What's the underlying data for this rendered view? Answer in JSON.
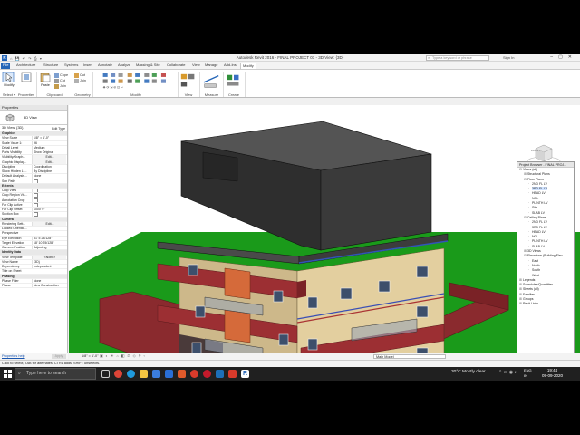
{
  "window": {
    "title": "Autodesk Revit 2016 -   FINAL PROJECT 01 - 3D View: {3D}",
    "search_placeholder": "Type a keyword or phrase",
    "sign_in": "Sign In",
    "quick_access": "⌂ 💾 ↶ ↷ ⎙ ▾"
  },
  "ribbon": {
    "tabs": [
      "File",
      "Architecture",
      "Structure",
      "Systems",
      "Insert",
      "Annotate",
      "Analyze",
      "Massing & Site",
      "Collaborate",
      "View",
      "Manage",
      "Add-Ins",
      "Modify"
    ],
    "active_tab": "Modify",
    "modify_label": "Modify",
    "properties_label": "Properties",
    "paste_label": "Paste",
    "clipboard_items": [
      "Cope",
      "Cut",
      "Join"
    ],
    "geometry_items": [
      "Cut",
      "Join"
    ],
    "panels": [
      "Select ▾",
      "Properties",
      "Clipboard",
      "Geometry",
      "Modify",
      "View",
      "Measure",
      "Create"
    ]
  },
  "properties": {
    "title": "Properties",
    "type_name": "3D View",
    "selector": "3D View: {3D}",
    "edit_type": "Edit Type",
    "rows": [
      {
        "k": "Graphics",
        "v": "",
        "cat": true
      },
      {
        "k": "View Scale",
        "v": "1/8\" = 1'-0\""
      },
      {
        "k": "Scale Value 1:",
        "v": "96"
      },
      {
        "k": "Detail Level",
        "v": "Medium"
      },
      {
        "k": "Parts Visibility",
        "v": "Show Original"
      },
      {
        "k": "Visibility/Graph...",
        "v": "Edit...",
        "btn": true
      },
      {
        "k": "Graphic Display...",
        "v": "Edit...",
        "btn": true
      },
      {
        "k": "Discipline",
        "v": "Coordination"
      },
      {
        "k": "Show Hidden Li...",
        "v": "By Discipline"
      },
      {
        "k": "Default Analysis...",
        "v": "None"
      },
      {
        "k": "Sun Path",
        "v": "",
        "chk": true
      },
      {
        "k": "Extents",
        "v": "",
        "cat": true
      },
      {
        "k": "Crop View",
        "v": "",
        "chk": true
      },
      {
        "k": "Crop Region Vis...",
        "v": "",
        "chk": true
      },
      {
        "k": "Annotation Crop",
        "v": "",
        "chk": true
      },
      {
        "k": "Far Clip Active",
        "v": "",
        "chk": true
      },
      {
        "k": "Far Clip Offset",
        "v": "1000' 0\""
      },
      {
        "k": "Section Box",
        "v": "",
        "chk": true
      },
      {
        "k": "Camera",
        "v": "",
        "cat": true
      },
      {
        "k": "Rendering Sett...",
        "v": "Edit...",
        "btn": true
      },
      {
        "k": "Locked Orientat...",
        "v": ""
      },
      {
        "k": "Perspective",
        "v": ""
      },
      {
        "k": "Eye Elevation",
        "v": "51' 5 23/128\""
      },
      {
        "k": "Target Elevation",
        "v": "18' 10 25/128\""
      },
      {
        "k": "Camera Position",
        "v": "Adjusting"
      },
      {
        "k": "Identity Data",
        "v": "",
        "cat": true
      },
      {
        "k": "View Template",
        "v": "<None>",
        "btn": true
      },
      {
        "k": "View Name",
        "v": "{3D}"
      },
      {
        "k": "Dependency",
        "v": "Independent"
      },
      {
        "k": "Title on Sheet",
        "v": ""
      },
      {
        "k": "Phasing",
        "v": "",
        "cat": true
      },
      {
        "k": "Phase Filter",
        "v": "None"
      },
      {
        "k": "Phase",
        "v": "New Construction"
      }
    ],
    "help_link": "Properties help",
    "apply": "Apply"
  },
  "browser": {
    "title": "Project Browser - FINAL PROJ...",
    "nodes": [
      {
        "t": "Views (all)",
        "d": 0,
        "tw": "⊟"
      },
      {
        "t": "Structural Plans",
        "d": 1,
        "tw": "⊞"
      },
      {
        "t": "Floor Plans",
        "d": 1,
        "tw": "⊟"
      },
      {
        "t": "2ND FL LV",
        "d": 2
      },
      {
        "t": "3RD FL LV",
        "d": 2,
        "sel": true
      },
      {
        "t": "HEAD LV",
        "d": 2
      },
      {
        "t": "NGL",
        "d": 2
      },
      {
        "t": "PLINTH LV",
        "d": 2
      },
      {
        "t": "Site",
        "d": 2
      },
      {
        "t": "SLAB LV",
        "d": 2
      },
      {
        "t": "Ceiling Plans",
        "d": 1,
        "tw": "⊟"
      },
      {
        "t": "2ND FL LV",
        "d": 2
      },
      {
        "t": "3RD FL LV",
        "d": 2
      },
      {
        "t": "HEAD LV",
        "d": 2
      },
      {
        "t": "NGL",
        "d": 2
      },
      {
        "t": "PLINTH LV",
        "d": 2
      },
      {
        "t": "SLAB LV",
        "d": 2
      },
      {
        "t": "3D Views",
        "d": 1,
        "tw": "⊞"
      },
      {
        "t": "Elevations (Building Elev...",
        "d": 1,
        "tw": "⊟"
      },
      {
        "t": "East",
        "d": 2
      },
      {
        "t": "North",
        "d": 2
      },
      {
        "t": "South",
        "d": 2
      },
      {
        "t": "West",
        "d": 2
      },
      {
        "t": "Legends",
        "d": 0,
        "tw": "⊞"
      },
      {
        "t": "Schedules/Quantities",
        "d": 0,
        "tw": "⊞"
      },
      {
        "t": "Sheets (all)",
        "d": 0,
        "tw": "⊞"
      },
      {
        "t": "Families",
        "d": 0,
        "tw": "⊞"
      },
      {
        "t": "Groups",
        "d": 0,
        "tw": "⊞"
      },
      {
        "t": "Revit Links",
        "d": 0,
        "tw": "⊞"
      }
    ]
  },
  "viewcube": {
    "face": "FRONT"
  },
  "viewbar": {
    "scale": "1/8\" = 1'-0\"",
    "model": "Main Model"
  },
  "statusbar": {
    "text": "Click to select, TAB for alternates, CTRL adds, SHIFT unselects."
  },
  "taskbar": {
    "search_placeholder": "Type here to search",
    "weather": "30°C  Mostly clear",
    "lang": "ENG\nIN",
    "time": "19:44",
    "date": "09-09-2020"
  },
  "colors": {
    "accent": "#2465b7",
    "roof": "#3f3f3f",
    "wall_cream": "#e3cf9f",
    "balcony_red": "#9c2f33",
    "grass": "#1a9a1a"
  }
}
